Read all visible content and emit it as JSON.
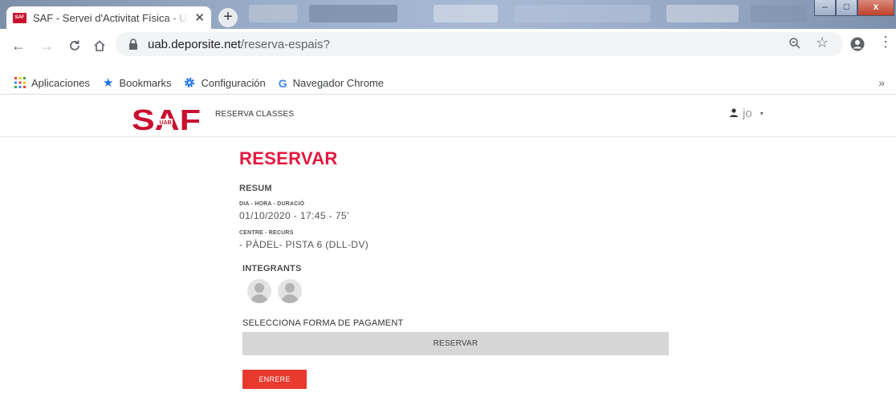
{
  "browser": {
    "tab_title": "SAF - Servei d'Activitat Física - UAB",
    "favicon_text": "SAF",
    "tab_close": "✕",
    "new_tab": "+",
    "url_domain": "uab.deporsite.net",
    "url_path": "/reserva-espais?",
    "window_controls": {
      "minimize": "–",
      "maximize": "□",
      "close": "x"
    },
    "bookmarks": [
      {
        "icon": "apps-grid-icon",
        "label": "Aplicaciones"
      },
      {
        "icon": "star-icon",
        "label": "Bookmarks"
      },
      {
        "icon": "settings-gear-icon",
        "label": "Configuración"
      },
      {
        "icon": "google-icon",
        "label": "Navegador Chrome"
      }
    ],
    "more_bookmarks": "»"
  },
  "site": {
    "logo_text": "SAF",
    "logo_sub": "UAB",
    "nav_link": "RESERVA CLASSES",
    "user_name": "jo",
    "brand_color": "#e3173d",
    "button_color": "#e8392f"
  },
  "booking": {
    "title": "RESERVAR",
    "summary_heading": "RESUM",
    "datetime_label": "DIA - HORA - DURACIÓ",
    "datetime_value": "01/10/2020 - 17:45 - 75'",
    "resource_label": "CENTRE - RECURS",
    "resource_value": "- PÀDEL- PISTA 6 (DLL-DV)",
    "members_heading": "INTEGRANTS",
    "members": [
      {
        "icon": "user-avatar-icon"
      },
      {
        "icon": "user-avatar-icon"
      }
    ],
    "payment_heading": "SELECCIONA FORMA DE PAGAMENT",
    "reserve_button": "RESERVAR",
    "back_button": "ENRERE"
  }
}
